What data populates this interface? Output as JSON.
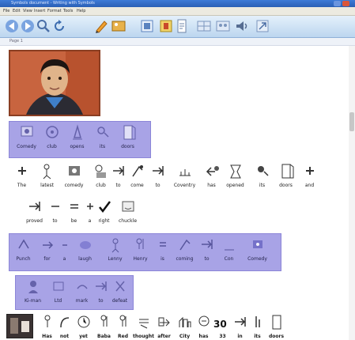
{
  "window": {
    "title": "Symbols document - Writing with Symbols"
  },
  "menu": [
    "File",
    "Edit",
    "View",
    "Insert",
    "Format",
    "Tools",
    "Help"
  ],
  "toolbar": [
    {
      "name": "back-icon"
    },
    {
      "name": "forward-icon"
    },
    {
      "name": "search-icon"
    },
    {
      "name": "refresh-icon"
    },
    {
      "name": "pencil-icon"
    },
    {
      "name": "picture-icon"
    },
    {
      "name": "book-icon"
    },
    {
      "name": "person-icon"
    },
    {
      "name": "page-icon"
    },
    {
      "name": "grid-icon"
    },
    {
      "name": "people-icon"
    },
    {
      "name": "speaker-icon"
    },
    {
      "name": "arrow-icon"
    }
  ],
  "status": "Page 1",
  "photo_caption": "",
  "rows": {
    "band1": [
      "Comedy",
      "club",
      "opens",
      "its",
      "doors"
    ],
    "sentence1": [
      "The",
      "latest",
      "comedy",
      "club",
      "to",
      "come",
      "to",
      "Coventry",
      "has",
      "opened",
      "its",
      "doors",
      "and"
    ],
    "sentence2": [
      "proved",
      "to",
      "be",
      "a",
      "right",
      "chuckle"
    ],
    "band2": [
      "Punch",
      "for",
      "a",
      "laugh",
      "Lenny",
      "Henry",
      "is",
      "coming",
      "to",
      "Con",
      "Comedy"
    ],
    "band3": [
      "Ki-man",
      "Ltd",
      "mark",
      "to",
      "defeat"
    ],
    "bottom": [
      "Has",
      "not",
      "yet",
      "Baba",
      "Red",
      "thought",
      "after",
      "City",
      "has",
      "33",
      "in",
      "its",
      "doors"
    ]
  },
  "bottom_number": "30",
  "colors": {
    "band": "#a8a3e6",
    "titlebar": "#2a5fb5",
    "toolbar": "#cfe2f5"
  }
}
